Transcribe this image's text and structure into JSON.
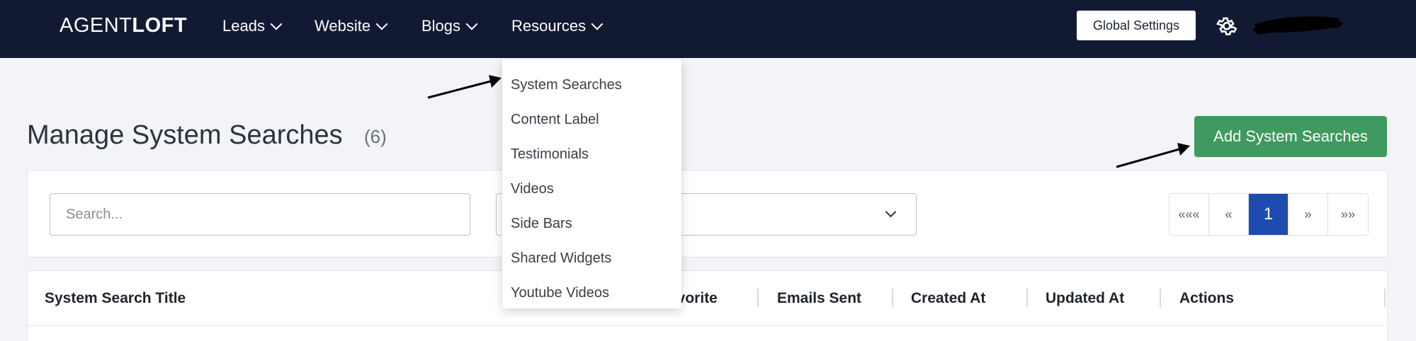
{
  "nav": {
    "brand_light": "AGENT",
    "brand_bold": "LOFT",
    "items": [
      {
        "label": "Leads"
      },
      {
        "label": "Website"
      },
      {
        "label": "Blogs"
      },
      {
        "label": "Resources"
      }
    ],
    "global_settings": "Global Settings"
  },
  "resources_menu": {
    "items": [
      {
        "label": "System Searches"
      },
      {
        "label": "Content Label"
      },
      {
        "label": "Testimonials"
      },
      {
        "label": "Videos"
      },
      {
        "label": "Side Bars"
      },
      {
        "label": "Shared Widgets"
      },
      {
        "label": "Youtube Videos"
      }
    ]
  },
  "page": {
    "title": "Manage System Searches",
    "count": "(6)",
    "add_button": "Add System Searches"
  },
  "filters": {
    "search_placeholder": "Search..."
  },
  "pagination": {
    "first": "«««",
    "prev": "«",
    "current": "1",
    "next": "»",
    "last": "»»"
  },
  "table": {
    "columns": [
      "System Search Title",
      "avorite",
      "Emails Sent",
      "Created At",
      "Updated At",
      "Actions"
    ]
  },
  "colors": {
    "navbar": "#121a33",
    "add_button": "#3f9a5f",
    "active_page": "#1e4bb0"
  }
}
